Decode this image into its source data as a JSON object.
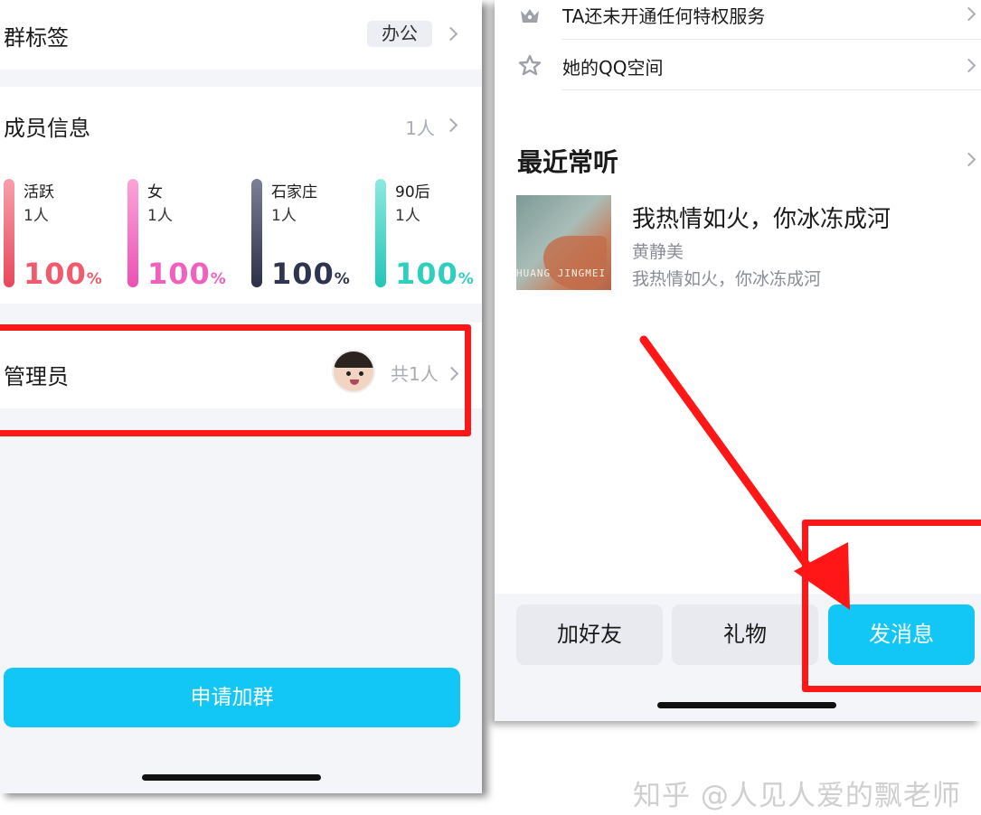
{
  "left": {
    "group_tag": {
      "label": "群标签",
      "value": "办公"
    },
    "members": {
      "label": "成员信息",
      "count": "1人",
      "stats": [
        {
          "label": "活跃",
          "count": "1人",
          "percent": "100",
          "unit": "%",
          "color": "#f06a7a"
        },
        {
          "label": "女",
          "count": "1人",
          "percent": "100",
          "unit": "%",
          "color": "#f56fc2"
        },
        {
          "label": "石家庄",
          "count": "1人",
          "percent": "100",
          "unit": "%",
          "color": "#3a4059"
        },
        {
          "label": "90后",
          "count": "1人",
          "percent": "100",
          "unit": "%",
          "color": "#39d2c4"
        }
      ]
    },
    "admins": {
      "label": "管理员",
      "count": "共1人"
    },
    "apply_button": "申请加群"
  },
  "right": {
    "rows": [
      {
        "text": "TA还未开通任何特权服务",
        "icon": "crown-icon"
      },
      {
        "text": "她的QQ空间",
        "icon": "star-icon"
      }
    ],
    "recent": {
      "title": "最近常听",
      "song": {
        "title": "我热情如火，你冰冻成河",
        "artist": "黄静美",
        "album": "我热情如火，你冰冻成河",
        "cover_text": "HUANG JINGMEI"
      }
    },
    "actions": {
      "add_friend": "加好友",
      "gift": "礼物",
      "send_message": "发消息"
    }
  },
  "watermark": "知乎 @人见人爱的飘老师",
  "colors": {
    "accent": "#12c6f6",
    "highlight": "#ff1717"
  }
}
